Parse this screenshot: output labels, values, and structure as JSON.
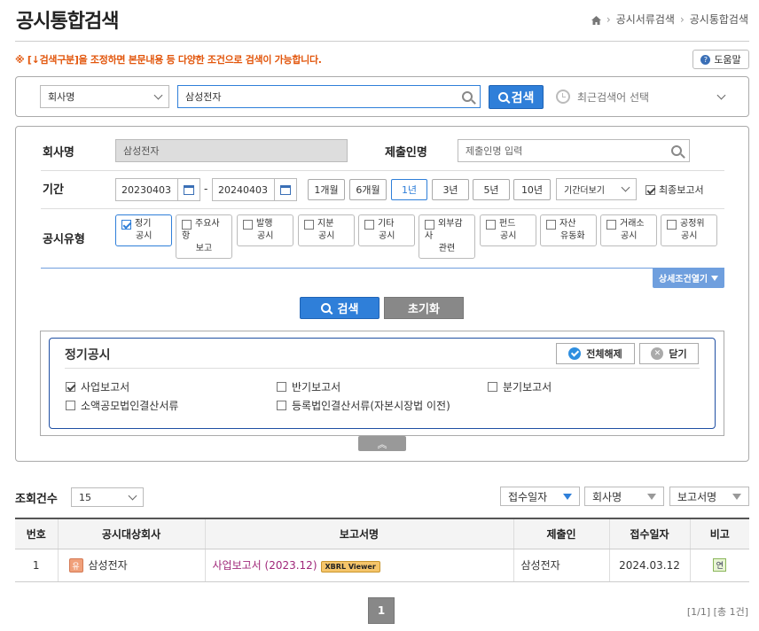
{
  "page": {
    "title": "공시통합검색"
  },
  "breadcrumb": [
    "공시서류검색",
    "공시통합검색"
  ],
  "notice": "※ [↓검색구분]을 조정하면 본문내용 등 다양한 조건으로 검색이 가능합니다.",
  "help_label": "도움말",
  "top_search": {
    "type_value": "회사명",
    "query_value": "삼성전자",
    "button": "검색",
    "recent_placeholder": "최근검색어 선택"
  },
  "filters": {
    "company_label": "회사명",
    "company_value": "삼성전자",
    "submitter_label": "제출인명",
    "submitter_placeholder": "제출인명 입력",
    "period_label": "기간",
    "date_from": "20230403",
    "date_sep": "-",
    "date_to": "20240403",
    "periods": [
      "1개월",
      "6개월",
      "1년",
      "3년",
      "5년",
      "10년"
    ],
    "period_more": "기간더보기",
    "final_report": "최종보고서",
    "type_label": "공시유형",
    "types": [
      {
        "l1": "정기",
        "l2": "공시",
        "l3": ""
      },
      {
        "l1": "주요사",
        "l2": "항",
        "l3": "보고"
      },
      {
        "l1": "발행",
        "l2": "공시",
        "l3": ""
      },
      {
        "l1": "지분",
        "l2": "공시",
        "l3": ""
      },
      {
        "l1": "기타",
        "l2": "공시",
        "l3": ""
      },
      {
        "l1": "외부감",
        "l2": "사",
        "l3": "관련"
      },
      {
        "l1": "펀드",
        "l2": "공시",
        "l3": ""
      },
      {
        "l1": "자산",
        "l2": "유동화",
        "l3": ""
      },
      {
        "l1": "거래소",
        "l2": "공시",
        "l3": ""
      },
      {
        "l1": "공정위",
        "l2": "공시",
        "l3": ""
      }
    ],
    "detail_toggle": "상세조건열기",
    "search_btn": "검색",
    "reset_btn": "초기화"
  },
  "regular": {
    "title": "정기공시",
    "clear_all": "전체해제",
    "close": "닫기",
    "items": [
      "사업보고서",
      "반기보고서",
      "분기보고서",
      "소액공모법인결산서류",
      "등록법인결산서류(자본시장법 이전)"
    ]
  },
  "results": {
    "count_label": "조회건수",
    "count_value": "15",
    "sort": [
      "접수일자",
      "회사명",
      "보고서명"
    ],
    "headers": [
      "번호",
      "공시대상회사",
      "보고서명",
      "제출인",
      "접수일자",
      "비고"
    ],
    "rows": [
      {
        "no": "1",
        "badge": "유",
        "company": "삼성전자",
        "report": "사업보고서 (2023.12)",
        "xbrl": "XBRL Viewer",
        "submitter": "삼성전자",
        "date": "2024.03.12",
        "note": "연"
      }
    ],
    "page": "1",
    "summary": "[1/1] [총 1건]"
  },
  "colors": {
    "accent": "#2f7fd9",
    "notice": "#e2560c",
    "report_link": "#a0287a"
  }
}
